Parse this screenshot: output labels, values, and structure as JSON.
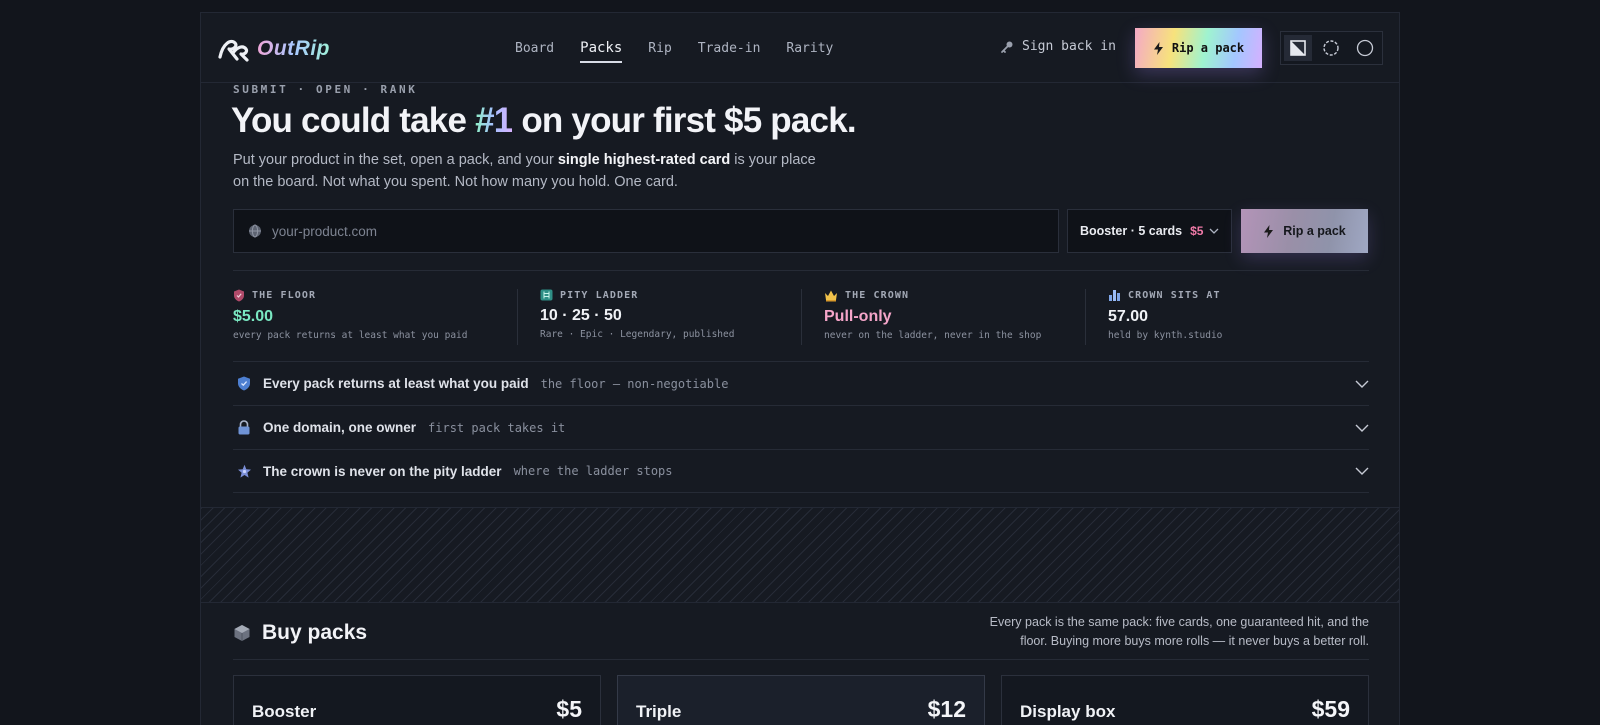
{
  "brand": {
    "name": "OutRip"
  },
  "nav": {
    "items": [
      {
        "label": "Board"
      },
      {
        "label": "Packs"
      },
      {
        "label": "Rip"
      },
      {
        "label": "Trade-in"
      },
      {
        "label": "Rarity"
      }
    ],
    "active": "Packs"
  },
  "header": {
    "signin_label": "Sign back in",
    "rip_label": "Rip a pack"
  },
  "hero": {
    "eyebrow": "SUBMIT · OPEN · RANK",
    "headline_pre": "You could take ",
    "headline_accent": "#1",
    "headline_post": " on your first $5 pack.",
    "sub_pre": "Put your product in the set, open a pack, and your ",
    "sub_bold": "single highest-rated card",
    "sub_post": " is your place on the board. Not what you spent. Not how many you hold. One card."
  },
  "form": {
    "url_placeholder": "your-product.com",
    "url_value": "",
    "pack_selected": "Booster · 5 cards",
    "pack_price": "$5",
    "rip_label": "Rip a pack"
  },
  "stats": [
    {
      "label": "THE FLOOR",
      "value": "$5.00",
      "note": "every pack returns at least what you paid",
      "icon": "shield-icon"
    },
    {
      "label": "PITY LADDER",
      "value": "10 · 25 · 50",
      "note": "Rare · Epic · Legendary, published",
      "icon": "ladder-icon"
    },
    {
      "label": "THE CROWN",
      "value": "Pull-only",
      "note": "never on the ladder, never in the shop",
      "icon": "crown-icon"
    },
    {
      "label": "CROWN SITS AT",
      "value": "57.00",
      "note": "held by kynth.studio",
      "icon": "bar-chart-icon"
    }
  ],
  "accordion": [
    {
      "title": "Every pack returns at least what you paid",
      "sub": "the floor — non-negotiable",
      "icon": "shield-check-icon"
    },
    {
      "title": "One domain, one owner",
      "sub": "first pack takes it",
      "icon": "lock-icon"
    },
    {
      "title": "The crown is never on the pity ladder",
      "sub": "where the ladder stops",
      "icon": "star-icon"
    }
  ],
  "buy": {
    "title": "Buy packs",
    "description": "Every pack is the same pack: five cards, one guaranteed hit, and the floor. Buying more buys more rolls — it never buys a better roll.",
    "cards": [
      {
        "name": "Booster",
        "price": "$5"
      },
      {
        "name": "Triple",
        "price": "$12"
      },
      {
        "name": "Display box",
        "price": "$59"
      }
    ]
  },
  "colors": {
    "background": "#12151c",
    "panel": "#161a22",
    "accent_green": "#7ae8c2",
    "accent_pink": "#f5a5c9",
    "price_pink": "#f07aa8"
  }
}
